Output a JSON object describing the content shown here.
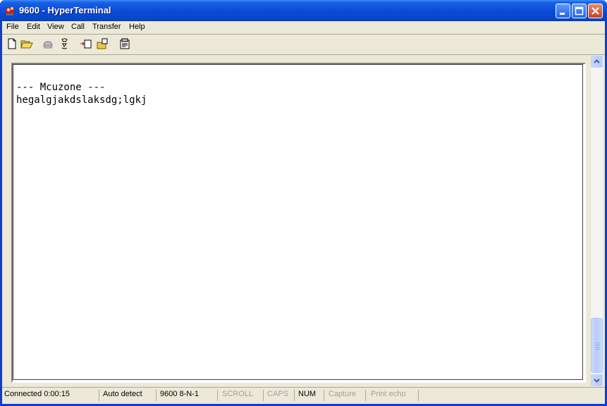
{
  "window": {
    "title": "9600 - HyperTerminal"
  },
  "menu": {
    "items": [
      "File",
      "Edit",
      "View",
      "Call",
      "Transfer",
      "Help"
    ]
  },
  "toolbar": {
    "icons": [
      "new-icon",
      "open-icon",
      "phone-icon",
      "disconnect-icon",
      "send-icon",
      "receive-icon",
      "properties-icon"
    ]
  },
  "terminal": {
    "lines": [
      "--- Mcuzone ---",
      "hegalgjakdslaksdg;lgkj"
    ]
  },
  "status": {
    "connected": "Connected 0:00:15",
    "detect": "Auto detect",
    "settings": "9600 8-N-1",
    "scroll": "SCROLL",
    "caps": "CAPS",
    "num": "NUM",
    "capture": "Capture",
    "print_echo": "Print echo"
  },
  "colors": {
    "titlebar": "#0a4ad6",
    "frame": "#ece9d8",
    "close_button": "#c8401e"
  }
}
